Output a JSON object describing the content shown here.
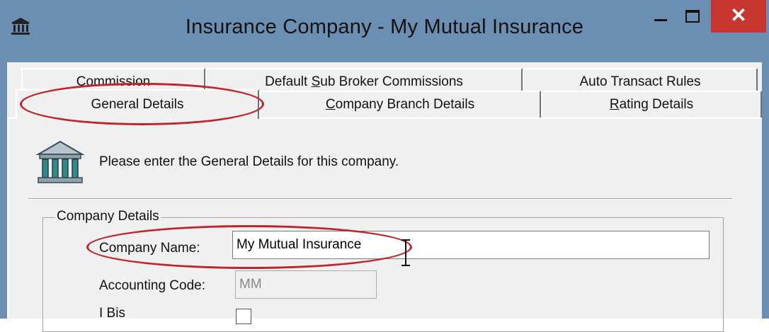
{
  "window": {
    "title": "Insurance Company - My Mutual Insurance",
    "app_icon": "bank-icon",
    "close_glyph": "✕"
  },
  "tabs_row1": [
    {
      "label_u": "C",
      "label_rest": "ommission"
    },
    {
      "label_pre": "Default ",
      "label_u": "S",
      "label_rest": "ub Broker Commissions"
    },
    {
      "label": "Auto Transact Rules"
    }
  ],
  "tabs_row2": [
    {
      "label_u": "G",
      "label_rest": "eneral Details",
      "active": true
    },
    {
      "label_u": "C",
      "label_rest": "ompany Branch Details"
    },
    {
      "label_u": "R",
      "label_rest": "ating Details"
    }
  ],
  "panel": {
    "intro": "Please enter the General Details for this company.",
    "intro_icon": "bank-icon"
  },
  "company_details": {
    "legend": "Company Details",
    "company_name_label": "Company Name:",
    "company_name_value": "My Mutual Insurance",
    "accounting_code_label": "Accounting Code:",
    "accounting_code_value": "MM",
    "third_label": "I Bis"
  },
  "highlight_color": "#c0242a"
}
